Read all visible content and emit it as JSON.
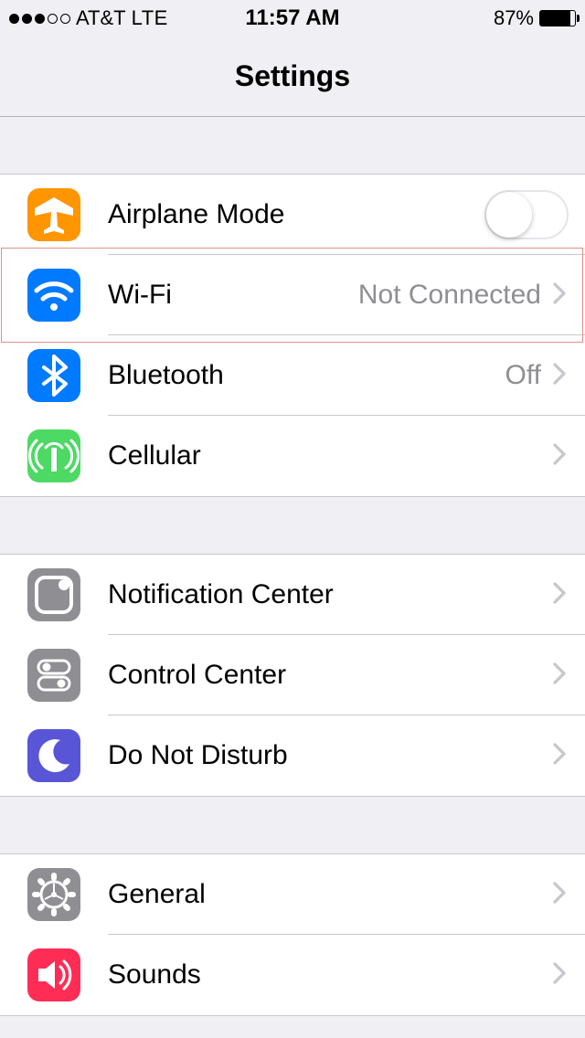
{
  "status": {
    "carrier": "AT&T",
    "network": "LTE",
    "time": "11:57 AM",
    "battery_pct": "87%",
    "battery_fill": "87%",
    "signal_filled": 3,
    "signal_total": 5
  },
  "header": {
    "title": "Settings"
  },
  "groups": [
    {
      "rows": [
        {
          "icon": "airplane-icon",
          "label": "Airplane Mode",
          "type": "toggle",
          "toggle": false,
          "icon_bg": "bg-orange",
          "highlighted": false
        },
        {
          "icon": "wifi-icon",
          "label": "Wi-Fi",
          "value": "Not Connected",
          "type": "link",
          "icon_bg": "bg-blue",
          "highlighted": true
        },
        {
          "icon": "bluetooth-icon",
          "label": "Bluetooth",
          "value": "Off",
          "type": "link",
          "icon_bg": "bg-blue",
          "highlighted": false
        },
        {
          "icon": "cellular-icon",
          "label": "Cellular",
          "type": "link",
          "icon_bg": "bg-green",
          "highlighted": false
        }
      ]
    },
    {
      "rows": [
        {
          "icon": "notification-center-icon",
          "label": "Notification Center",
          "type": "link",
          "icon_bg": "bg-gray",
          "highlighted": false
        },
        {
          "icon": "control-center-icon",
          "label": "Control Center",
          "type": "link",
          "icon_bg": "bg-gray",
          "highlighted": false
        },
        {
          "icon": "do-not-disturb-icon",
          "label": "Do Not Disturb",
          "type": "link",
          "icon_bg": "bg-indigo",
          "highlighted": false
        }
      ]
    },
    {
      "rows": [
        {
          "icon": "general-icon",
          "label": "General",
          "type": "link",
          "icon_bg": "bg-gray",
          "highlighted": false
        },
        {
          "icon": "sounds-icon",
          "label": "Sounds",
          "type": "link",
          "icon_bg": "bg-red",
          "highlighted": false
        }
      ]
    }
  ]
}
